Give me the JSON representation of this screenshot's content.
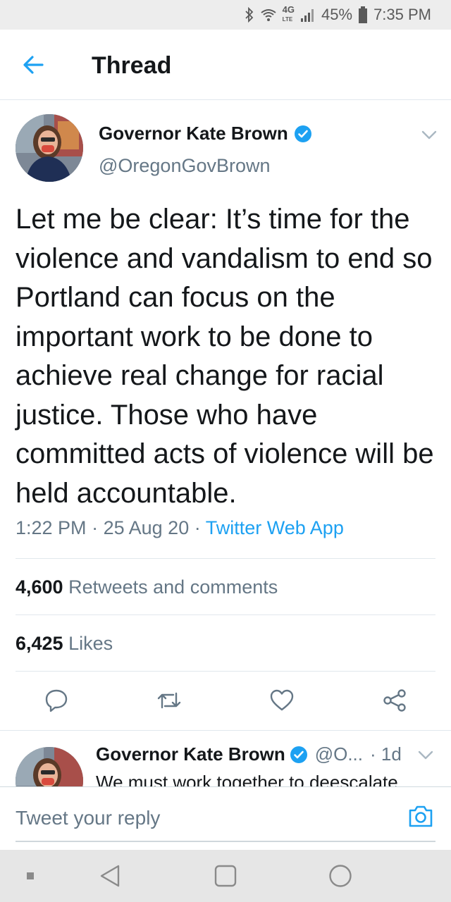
{
  "status_bar": {
    "network": "4G",
    "network_sub": "LTE",
    "battery": "45%",
    "time": "7:35 PM",
    "icons": [
      "bluetooth-icon",
      "wifi-icon",
      "signal-icon",
      "battery-icon"
    ]
  },
  "header": {
    "title": "Thread",
    "back_icon": "back-arrow-icon"
  },
  "tweet": {
    "author_name": "Governor Kate Brown",
    "handle": "@OregonGovBrown",
    "text": "Let me be clear: It’s time for the violence and vandalism to end so Portland can focus on the important work to be done to achieve real change for racial justice. Those who have committed acts of violence will be held accountable.",
    "time": "1:22 PM",
    "date": "25 Aug 20",
    "separator": "·",
    "source": "Twitter Web App",
    "retweets_count": "4,600",
    "retweets_label": "Retweets and comments",
    "likes_count": "6,425",
    "likes_label": "Likes"
  },
  "reply_preview": {
    "author_name": "Governor Kate Brown",
    "handle": "@O...",
    "time": "· 1d",
    "text": "We must work together to deescalate"
  },
  "compose": {
    "placeholder": "Tweet your reply"
  },
  "colors": {
    "accent": "#1da1f2",
    "secondary_text": "#657786",
    "primary_text": "#14171a"
  }
}
